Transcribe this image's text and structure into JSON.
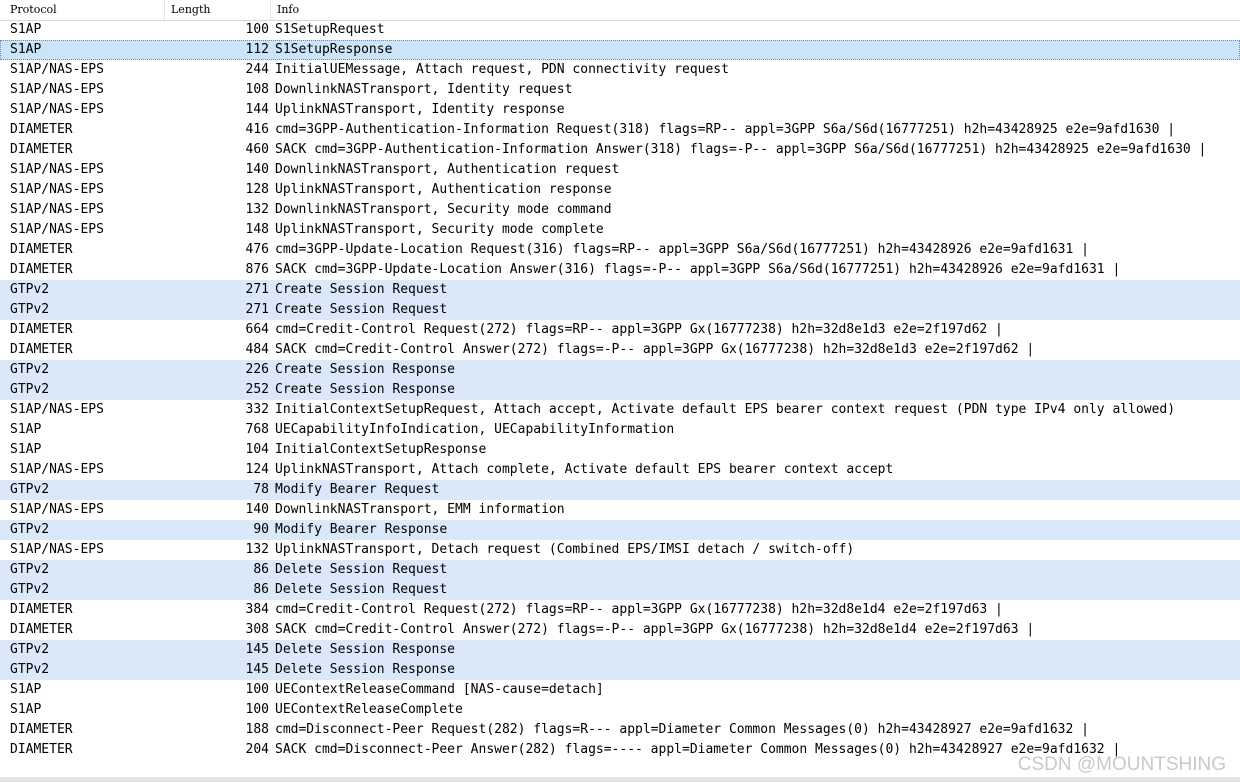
{
  "columns": {
    "protocol": "Protocol",
    "length": "Length",
    "info": "Info"
  },
  "watermark": "CSDN @MOUNTSHING",
  "selected_row": 1,
  "colors": {
    "gtpv2_row": "#dae8fa",
    "selected_row": "#cce4f7"
  },
  "rows": [
    {
      "protocol": "S1AP",
      "length": "100",
      "info": "S1SetupRequest"
    },
    {
      "protocol": "S1AP",
      "length": "112",
      "info": "S1SetupResponse"
    },
    {
      "protocol": "S1AP/NAS-EPS",
      "length": "244",
      "info": "InitialUEMessage, Attach request, PDN connectivity request"
    },
    {
      "protocol": "S1AP/NAS-EPS",
      "length": "108",
      "info": "DownlinkNASTransport, Identity request"
    },
    {
      "protocol": "S1AP/NAS-EPS",
      "length": "144",
      "info": "UplinkNASTransport, Identity response"
    },
    {
      "protocol": "DIAMETER",
      "length": "416",
      "info": "cmd=3GPP-Authentication-Information Request(318) flags=RP-- appl=3GPP S6a/S6d(16777251) h2h=43428925 e2e=9afd1630 |"
    },
    {
      "protocol": "DIAMETER",
      "length": "460",
      "info": "SACK cmd=3GPP-Authentication-Information Answer(318) flags=-P-- appl=3GPP S6a/S6d(16777251) h2h=43428925 e2e=9afd1630 |"
    },
    {
      "protocol": "S1AP/NAS-EPS",
      "length": "140",
      "info": "DownlinkNASTransport, Authentication request"
    },
    {
      "protocol": "S1AP/NAS-EPS",
      "length": "128",
      "info": "UplinkNASTransport, Authentication response"
    },
    {
      "protocol": "S1AP/NAS-EPS",
      "length": "132",
      "info": "DownlinkNASTransport, Security mode command"
    },
    {
      "protocol": "S1AP/NAS-EPS",
      "length": "148",
      "info": "UplinkNASTransport, Security mode complete"
    },
    {
      "protocol": "DIAMETER",
      "length": "476",
      "info": "cmd=3GPP-Update-Location Request(316) flags=RP-- appl=3GPP S6a/S6d(16777251) h2h=43428926 e2e=9afd1631 |"
    },
    {
      "protocol": "DIAMETER",
      "length": "876",
      "info": "SACK cmd=3GPP-Update-Location Answer(316) flags=-P-- appl=3GPP S6a/S6d(16777251) h2h=43428926 e2e=9afd1631 |"
    },
    {
      "protocol": "GTPv2",
      "length": "271",
      "info": "Create Session Request"
    },
    {
      "protocol": "GTPv2",
      "length": "271",
      "info": "Create Session Request"
    },
    {
      "protocol": "DIAMETER",
      "length": "664",
      "info": "cmd=Credit-Control Request(272) flags=RP-- appl=3GPP Gx(16777238) h2h=32d8e1d3 e2e=2f197d62 |"
    },
    {
      "protocol": "DIAMETER",
      "length": "484",
      "info": "SACK cmd=Credit-Control Answer(272) flags=-P-- appl=3GPP Gx(16777238) h2h=32d8e1d3 e2e=2f197d62 |"
    },
    {
      "protocol": "GTPv2",
      "length": "226",
      "info": "Create Session Response"
    },
    {
      "protocol": "GTPv2",
      "length": "252",
      "info": "Create Session Response"
    },
    {
      "protocol": "S1AP/NAS-EPS",
      "length": "332",
      "info": "InitialContextSetupRequest, Attach accept, Activate default EPS bearer context request (PDN type IPv4 only allowed)"
    },
    {
      "protocol": "S1AP",
      "length": "768",
      "info": "UECapabilityInfoIndication, UECapabilityInformation"
    },
    {
      "protocol": "S1AP",
      "length": "104",
      "info": "InitialContextSetupResponse"
    },
    {
      "protocol": "S1AP/NAS-EPS",
      "length": "124",
      "info": "UplinkNASTransport, Attach complete, Activate default EPS bearer context accept"
    },
    {
      "protocol": "GTPv2",
      "length": "78",
      "info": "Modify Bearer Request"
    },
    {
      "protocol": "S1AP/NAS-EPS",
      "length": "140",
      "info": "DownlinkNASTransport, EMM information"
    },
    {
      "protocol": "GTPv2",
      "length": "90",
      "info": "Modify Bearer Response"
    },
    {
      "protocol": "S1AP/NAS-EPS",
      "length": "132",
      "info": "UplinkNASTransport, Detach request (Combined EPS/IMSI detach / switch-off)"
    },
    {
      "protocol": "GTPv2",
      "length": "86",
      "info": "Delete Session Request"
    },
    {
      "protocol": "GTPv2",
      "length": "86",
      "info": "Delete Session Request"
    },
    {
      "protocol": "DIAMETER",
      "length": "384",
      "info": "cmd=Credit-Control Request(272) flags=RP-- appl=3GPP Gx(16777238) h2h=32d8e1d4 e2e=2f197d63 |"
    },
    {
      "protocol": "DIAMETER",
      "length": "308",
      "info": "SACK cmd=Credit-Control Answer(272) flags=-P-- appl=3GPP Gx(16777238) h2h=32d8e1d4 e2e=2f197d63 |"
    },
    {
      "protocol": "GTPv2",
      "length": "145",
      "info": "Delete Session Response"
    },
    {
      "protocol": "GTPv2",
      "length": "145",
      "info": "Delete Session Response"
    },
    {
      "protocol": "S1AP",
      "length": "100",
      "info": "UEContextReleaseCommand [NAS-cause=detach]"
    },
    {
      "protocol": "S1AP",
      "length": "100",
      "info": "UEContextReleaseComplete"
    },
    {
      "protocol": "DIAMETER",
      "length": "188",
      "info": "cmd=Disconnect-Peer Request(282) flags=R--- appl=Diameter Common Messages(0) h2h=43428927 e2e=9afd1632 |"
    },
    {
      "protocol": "DIAMETER",
      "length": "204",
      "info": "SACK cmd=Disconnect-Peer Answer(282) flags=---- appl=Diameter Common Messages(0) h2h=43428927 e2e=9afd1632 |"
    }
  ]
}
